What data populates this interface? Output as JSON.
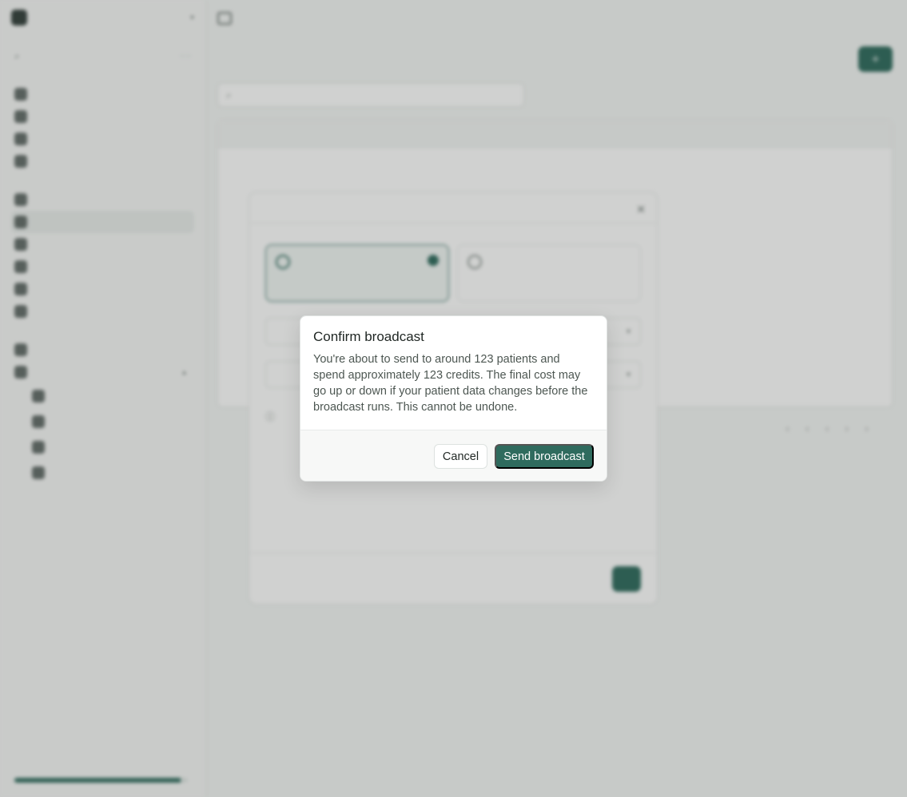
{
  "confirm_dialog": {
    "title": "Confirm broadcast",
    "message": "You're about to send to around 123 patients and spend approximately 123 credits. The final cost may go up or down if your patient data changes before the broadcast runs. This cannot be undone.",
    "cancel_label": "Cancel",
    "confirm_label": "Send broadcast"
  },
  "colors": {
    "primary": "#2f6b5e",
    "overlay": "rgba(40,44,42,0.22)"
  }
}
